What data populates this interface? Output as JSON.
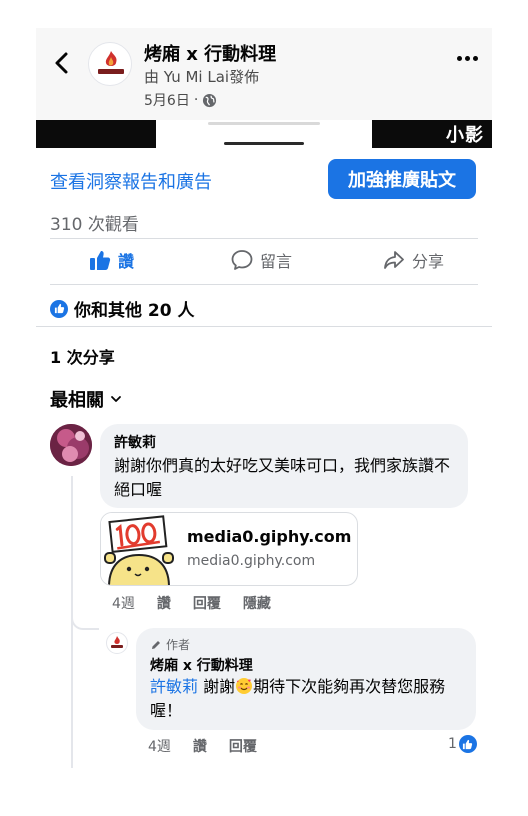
{
  "header": {
    "page_name": "烤廂 x 行動料理",
    "posted_by": "由 Yu Mi Lai發佈",
    "date": "5月6日",
    "date_sep": "·"
  },
  "media": {
    "watermark": "小影"
  },
  "insights": {
    "link_label": "查看洞察報告和廣告",
    "boost_label": "加強推廣貼文",
    "views": "310 次觀看"
  },
  "actions": {
    "like": "讚",
    "comment": "留言",
    "share": "分享"
  },
  "reactions": {
    "summary": "你和其他 20 人"
  },
  "shares": {
    "count_label": "1 次分享"
  },
  "sort": {
    "label": "最相關"
  },
  "comment": {
    "author": "許敏莉",
    "text": "謝謝你們真的太好吃又美味可口，我們家族讚不絕口喔",
    "attachment": {
      "title": "media0.giphy.com",
      "domain": "media0.giphy.com"
    },
    "time": "4週",
    "like": "讚",
    "reply": "回覆",
    "hide": "隱藏"
  },
  "reply": {
    "author_tag": "作者",
    "author": "烤廂 x 行動料理",
    "mention": "許敏莉",
    "text_before_emoji": "謝謝",
    "text_after_emoji": "期待下次能夠再次替您服務喔！",
    "time": "4週",
    "like": "讚",
    "reply": "回覆",
    "like_count": "1"
  },
  "colors": {
    "accent": "#1b74e4",
    "bubble": "#f0f2f5",
    "secondary_text": "#65676b"
  }
}
